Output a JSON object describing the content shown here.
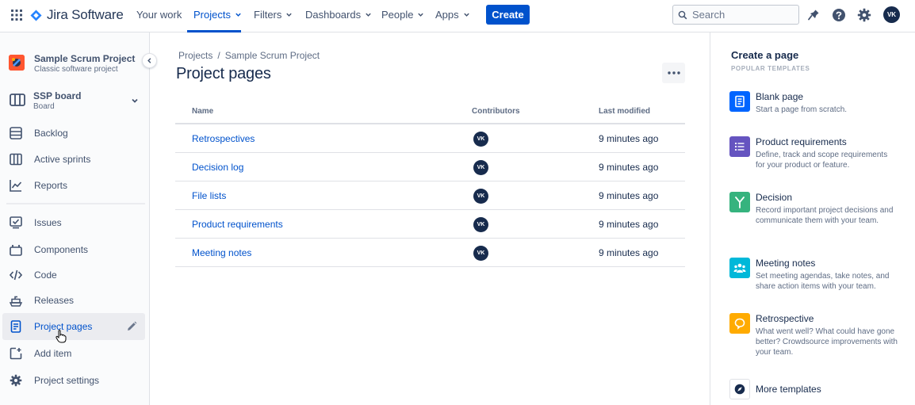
{
  "topnav": {
    "product_name": "Jira Software",
    "items": [
      {
        "label": "Your work",
        "has_menu": false
      },
      {
        "label": "Projects",
        "has_menu": true,
        "active": true
      },
      {
        "label": "Filters",
        "has_menu": true
      },
      {
        "label": "Dashboards",
        "has_menu": true
      },
      {
        "label": "People",
        "has_menu": true
      },
      {
        "label": "Apps",
        "has_menu": true
      }
    ],
    "create_label": "Create",
    "search_placeholder": "Search",
    "avatar_initials": "VK",
    "accent_color": "#0052cc"
  },
  "sidebar": {
    "project_name": "Sample Scrum Project",
    "project_type": "Classic software project",
    "board_name": "SSP board",
    "board_type": "Board",
    "items": [
      {
        "label": "Backlog",
        "icon": "backlog-icon"
      },
      {
        "label": "Active sprints",
        "icon": "board-columns-icon"
      },
      {
        "label": "Reports",
        "icon": "reports-icon"
      },
      {
        "label": "Issues",
        "icon": "issues-icon"
      },
      {
        "label": "Components",
        "icon": "components-icon"
      },
      {
        "label": "Code",
        "icon": "code-icon"
      },
      {
        "label": "Releases",
        "icon": "releases-icon"
      },
      {
        "label": "Project pages",
        "icon": "page-icon",
        "selected": true
      },
      {
        "label": "Add item",
        "icon": "add-item-icon"
      },
      {
        "label": "Project settings",
        "icon": "settings-icon"
      }
    ]
  },
  "main": {
    "breadcrumb": [
      "Projects",
      "Sample Scrum Project"
    ],
    "breadcrumb_separator": "/",
    "title": "Project pages",
    "columns": [
      "Name",
      "Contributors",
      "Last modified"
    ],
    "rows": [
      {
        "name": "Retrospectives",
        "contributor": "VK",
        "modified": "9 minutes ago"
      },
      {
        "name": "Decision log",
        "contributor": "VK",
        "modified": "9 minutes ago"
      },
      {
        "name": "File lists",
        "contributor": "VK",
        "modified": "9 minutes ago"
      },
      {
        "name": "Product requirements",
        "contributor": "VK",
        "modified": "9 minutes ago"
      },
      {
        "name": "Meeting notes",
        "contributor": "VK",
        "modified": "9 minutes ago"
      }
    ]
  },
  "panel": {
    "title": "Create a page",
    "subtitle": "POPULAR TEMPLATES",
    "templates": [
      {
        "name": "Blank page",
        "desc": "Start a page from scratch.",
        "icon": "blank-page-icon",
        "color": "#0065ff"
      },
      {
        "name": "Product requirements",
        "desc": "Define, track and scope requirements for your product or feature.",
        "icon": "list-icon",
        "color": "#6554c0"
      },
      {
        "name": "Decision",
        "desc": "Record important project decisions and communicate them with your team.",
        "icon": "decision-fork-icon",
        "color": "#36b37e"
      },
      {
        "name": "Meeting notes",
        "desc": "Set meeting agendas, take notes, and share action items with your team.",
        "icon": "people-icon",
        "color": "#00b8d9"
      },
      {
        "name": "Retrospective",
        "desc": "What went well? What could have gone better? Crowdsource improvements with your team.",
        "icon": "retrospective-icon",
        "color": "#ffab00"
      }
    ],
    "more_label": "More templates"
  }
}
